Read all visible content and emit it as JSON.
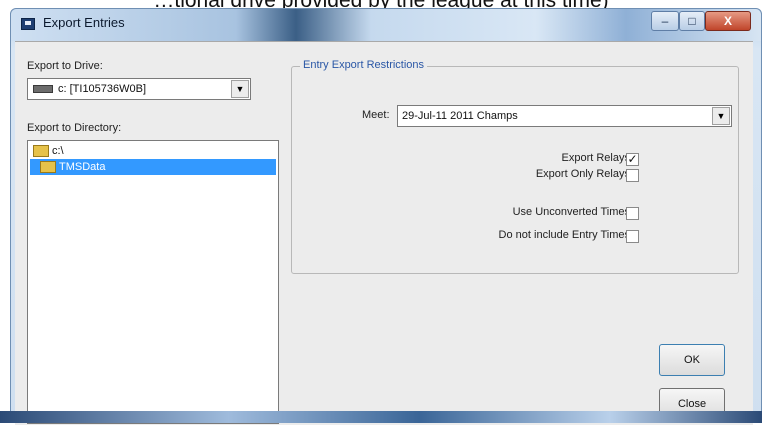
{
  "overhang_text": "…tional drive provided by the league at this time)",
  "window": {
    "title": "Export Entries",
    "buttons": {
      "minimize": "–",
      "maximize": "□",
      "close": "X"
    }
  },
  "left": {
    "export_drive_label": "Export to Drive:",
    "drive_value": "c: [TI105736W0B]",
    "export_dir_label": "Export to Directory:",
    "directories": [
      {
        "label": "c:\\",
        "selected": false
      },
      {
        "label": "TMSData",
        "selected": true
      }
    ]
  },
  "restrictions": {
    "group_title": "Entry Export Restrictions",
    "meet_label": "Meet:",
    "meet_value": "29-Jul-11 2011 Champs",
    "options": [
      {
        "label": "Export Relays",
        "checked": true,
        "check_mark": "✓"
      },
      {
        "label": "Export Only Relays",
        "checked": false,
        "check_mark": ""
      },
      {
        "label": "Use Unconverted Times",
        "checked": false,
        "check_mark": ""
      },
      {
        "label": "Do not include Entry Times",
        "checked": false,
        "check_mark": ""
      }
    ]
  },
  "actions": {
    "ok": "OK",
    "close": "Close"
  },
  "colors": {
    "selection": "#3399ff",
    "group_title": "#2a57a6",
    "close_button": "#c0452b"
  },
  "icons": {
    "app": "export-app-icon",
    "drive": "hard-drive-icon",
    "folder": "folder-icon",
    "dropdown": "chevron-down-icon"
  }
}
